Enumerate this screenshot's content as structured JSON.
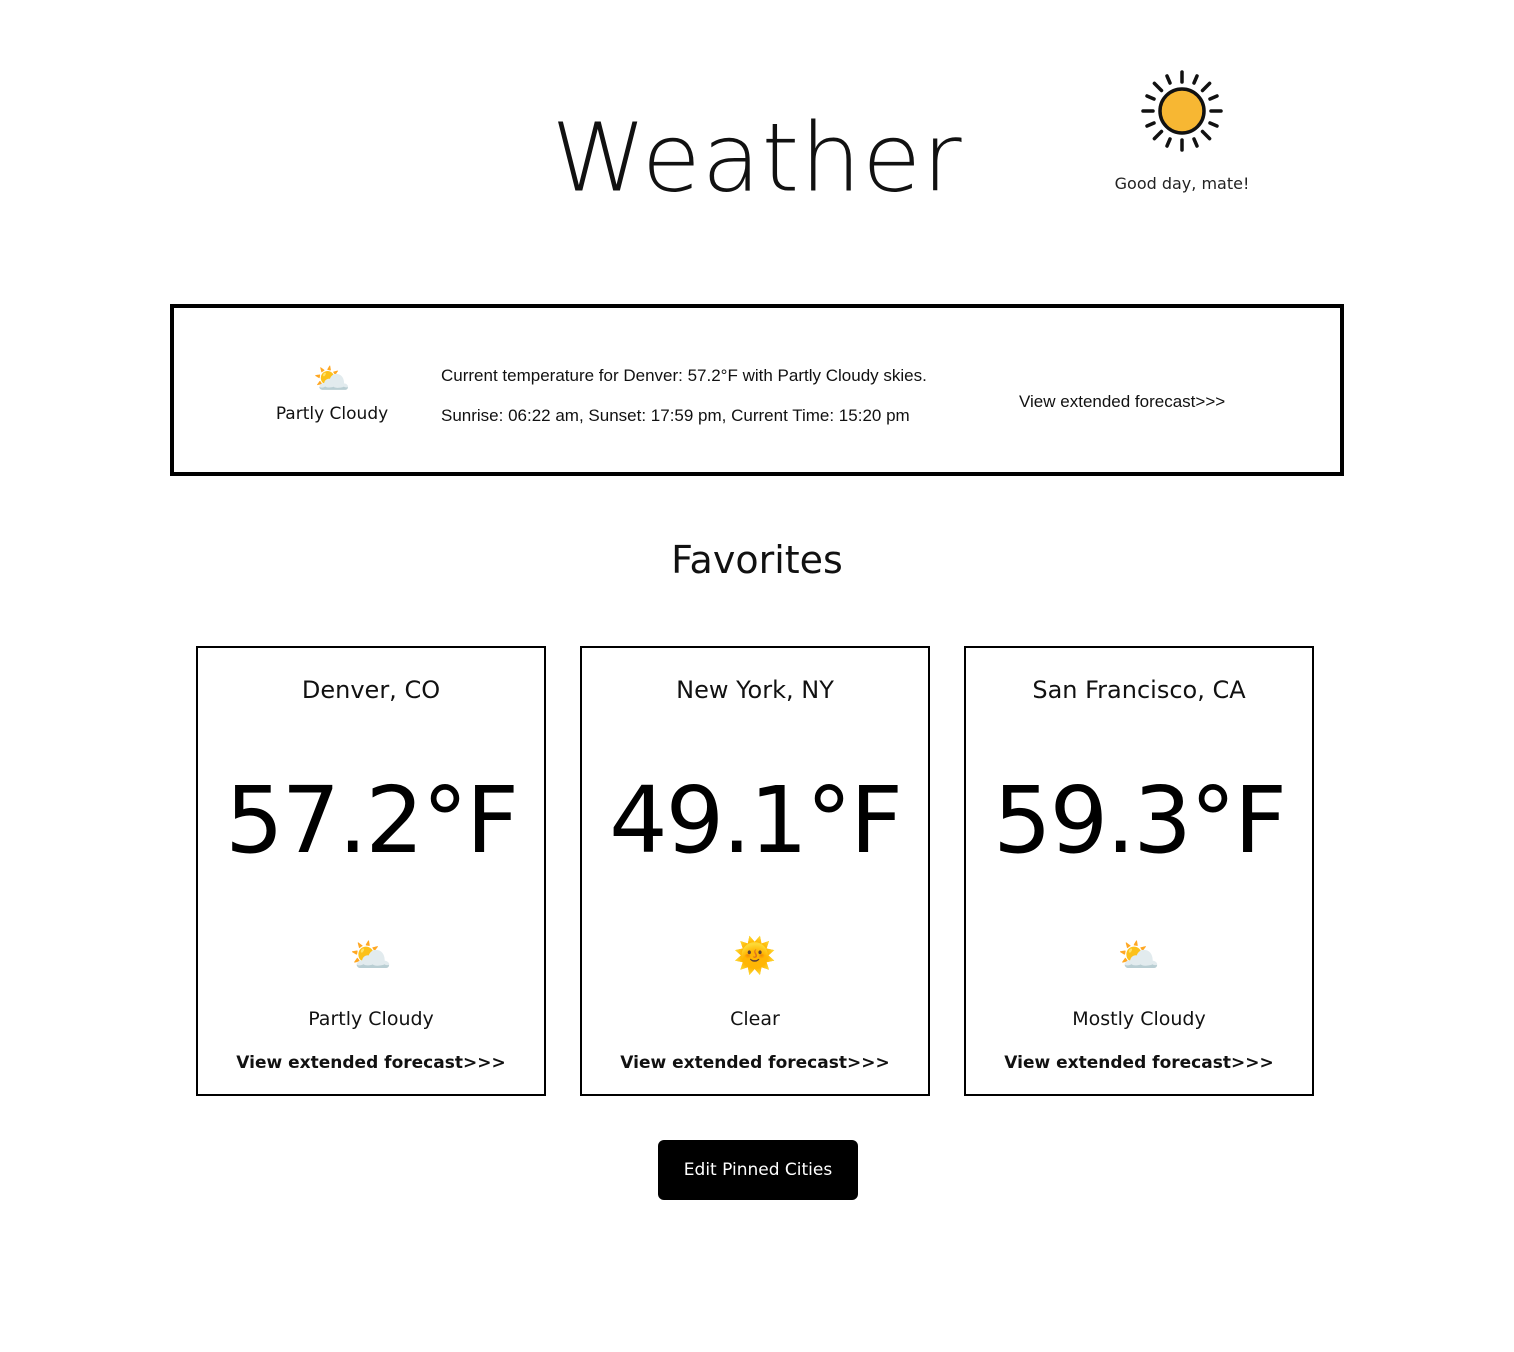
{
  "header": {
    "title": "Weather",
    "greeting": "Good day, mate!",
    "greeting_icon": "sun-icon",
    "sun_color": "#F7B733"
  },
  "current": {
    "icon": "partly-cloudy-icon",
    "glyph": "⛅",
    "condition": "Partly Cloudy",
    "line1": "Current temperature for Denver: 57.2°F with Partly Cloudy skies.",
    "line2": "Sunrise: 06:22 am, Sunset: 17:59 pm, Current Time: 15:20 pm",
    "forecast_link": "View extended forecast>>>"
  },
  "favorites": {
    "heading": "Favorites",
    "cards": [
      {
        "city": "Denver, CO",
        "temp": "57.2°F",
        "icon": "partly-cloudy-icon",
        "glyph": "⛅",
        "condition": "Partly Cloudy",
        "forecast_link": "View extended forecast>>>"
      },
      {
        "city": "New York, NY",
        "temp": "49.1°F",
        "icon": "sun-icon",
        "glyph": "🌞",
        "condition": "Clear",
        "forecast_link": "View extended forecast>>>"
      },
      {
        "city": "San Francisco, CA",
        "temp": "59.3°F",
        "icon": "partly-cloudy-icon",
        "glyph": "⛅",
        "condition": "Mostly Cloudy",
        "forecast_link": "View extended forecast>>>"
      }
    ]
  },
  "actions": {
    "edit_label": "Edit Pinned Cities"
  }
}
